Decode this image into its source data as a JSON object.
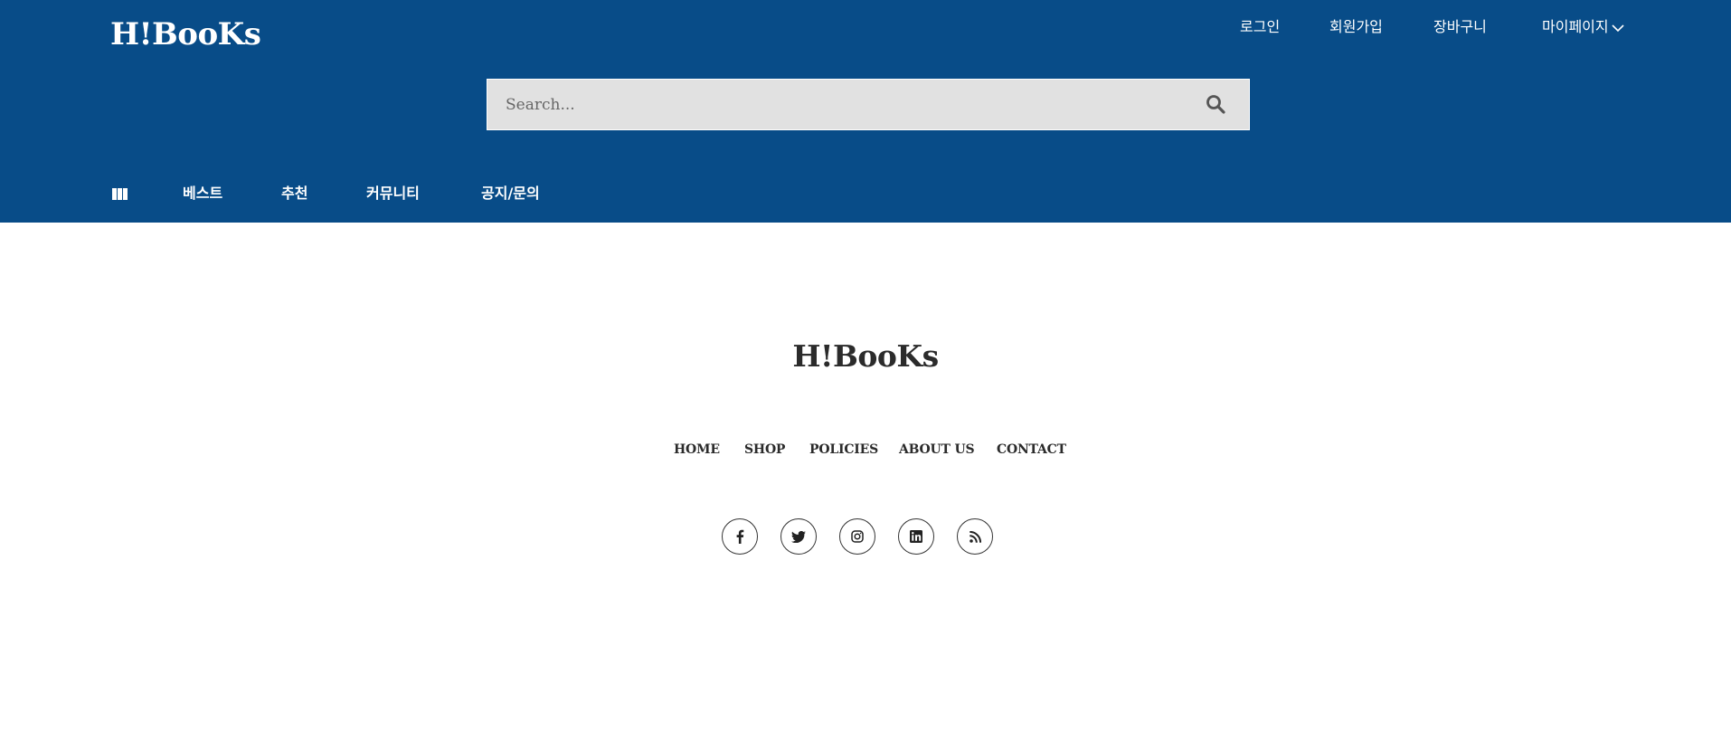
{
  "header": {
    "logo": "H!BooKs",
    "top_links": [
      {
        "label": "로그인"
      },
      {
        "label": "회원가입"
      },
      {
        "label": "장바구니"
      },
      {
        "label": "마이페이지",
        "icon": "chevron-down-icon"
      }
    ],
    "search": {
      "placeholder": "Search...",
      "value": "",
      "icon": "search-icon"
    },
    "nav": {
      "menu_icon": "book-columns-icon",
      "items": [
        {
          "label": "베스트"
        },
        {
          "label": "추천"
        },
        {
          "label": "커뮤니티"
        },
        {
          "label": "공지/문의"
        }
      ]
    }
  },
  "footer": {
    "logo": "H!BooKs",
    "nav": [
      {
        "label": "HOME"
      },
      {
        "label": "SHOP"
      },
      {
        "label": "POLICIES"
      },
      {
        "label": "ABOUT US"
      },
      {
        "label": "CONTACT"
      }
    ],
    "social": [
      {
        "icon": "facebook-icon"
      },
      {
        "icon": "twitter-icon"
      },
      {
        "icon": "instagram-icon"
      },
      {
        "icon": "linkedin-icon"
      },
      {
        "icon": "rss-icon"
      }
    ]
  },
  "colors": {
    "header_bg": "#084c88",
    "search_bg": "#e1e1e1",
    "text_dark": "#2b2b2b",
    "white": "#ffffff"
  }
}
